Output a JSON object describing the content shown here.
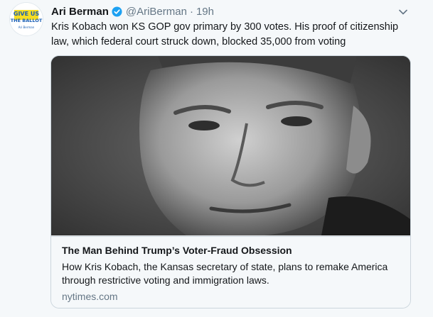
{
  "tweet": {
    "author_name": "Ari Berman",
    "handle": "@AriBerman",
    "separator": "·",
    "timestamp": "19h",
    "verified": true,
    "avatar": {
      "line1": "GIVE US",
      "line2": "THE BALLOT",
      "line3": "Ari Berman",
      "accent": "#1a5fb4",
      "highlight": "#f5d90a"
    },
    "text": "Kris Kobach won KS GOP gov primary by 300 votes. His proof of citizenship law, which federal court struck down, blocked 35,000 from voting",
    "icons": {
      "verified": "verified-badge-icon",
      "menu": "chevron-down-icon"
    }
  },
  "card": {
    "image_alt": "black-and-white close-up portrait of a man",
    "title": "The Man Behind Trump’s Voter-Fraud Obsession",
    "description": "How Kris Kobach, the Kansas secretary of state, plans to remake America through restrictive voting and immigration laws.",
    "domain": "nytimes.com"
  },
  "colors": {
    "background": "#f5f8fa",
    "text": "#14171a",
    "secondary": "#657786",
    "verified_blue": "#1da1f2",
    "border": "#ccd6dd"
  }
}
